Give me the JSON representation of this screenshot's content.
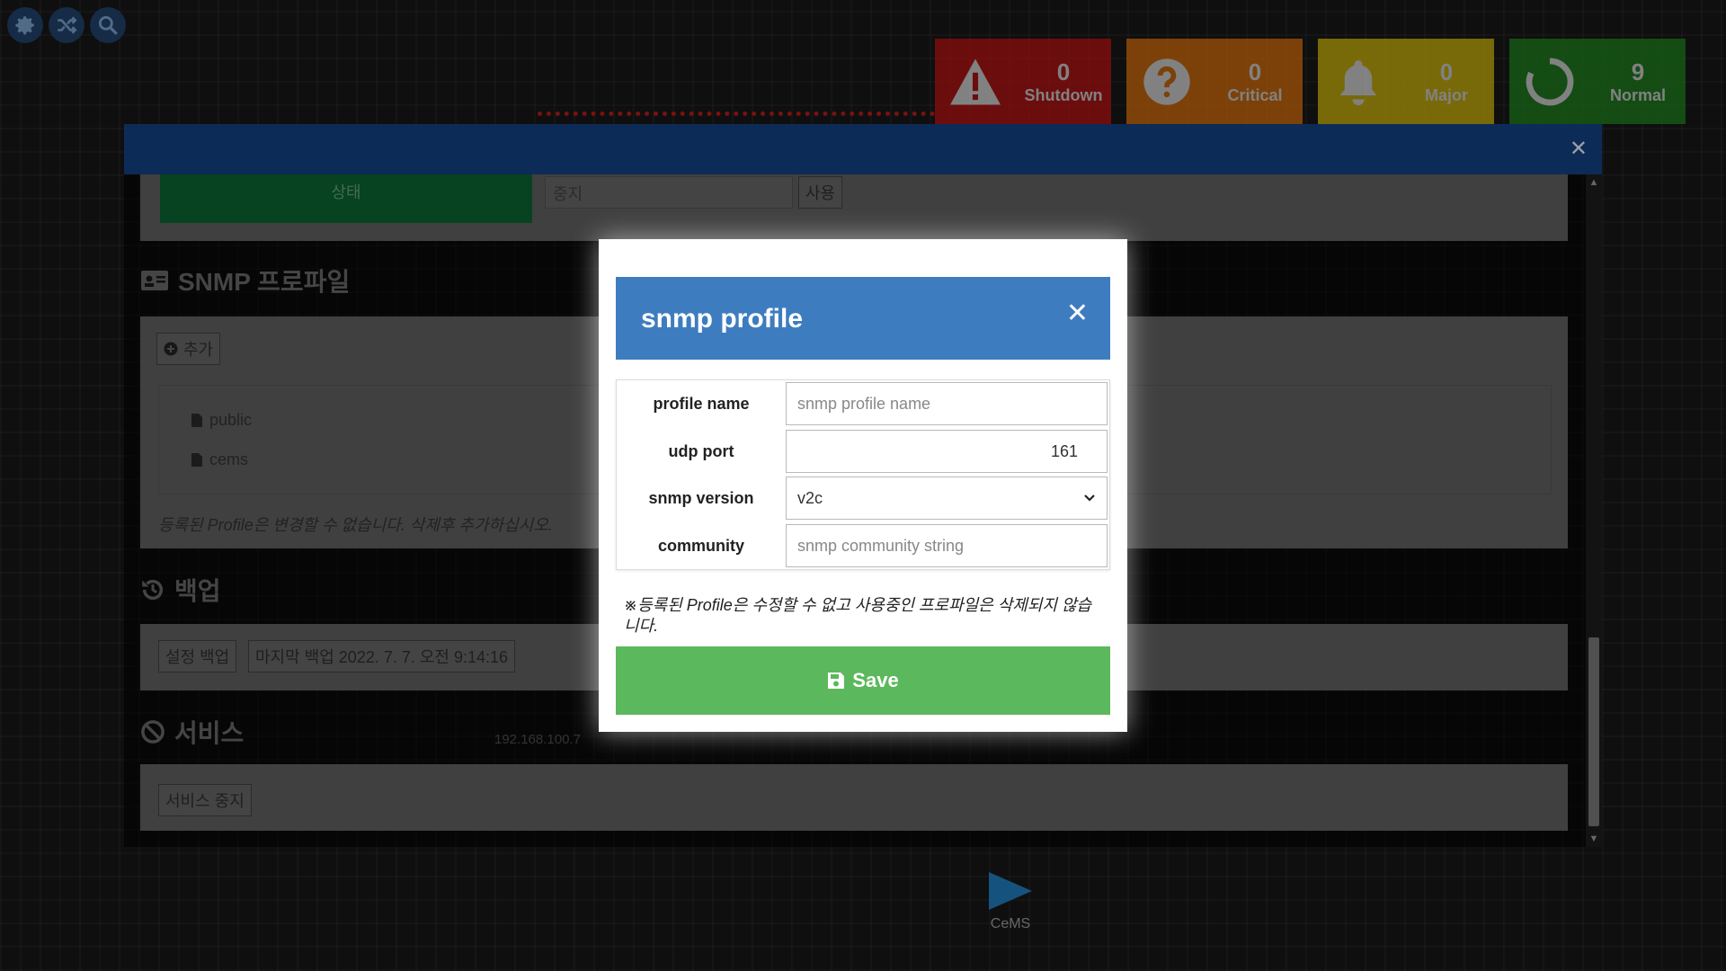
{
  "toolbar": {
    "icons": [
      "settings-icon",
      "shuffle-icon",
      "search-icon"
    ]
  },
  "status": [
    {
      "name": "shutdown",
      "count": "0",
      "label": "Shutdown",
      "color": "#b31212",
      "icon": "warning-icon"
    },
    {
      "name": "critical",
      "count": "0",
      "label": "Critical",
      "color": "#d06a0a",
      "icon": "question-icon"
    },
    {
      "name": "major",
      "count": "0",
      "label": "Major",
      "color": "#c9b00a",
      "icon": "bell-icon"
    },
    {
      "name": "normal",
      "count": "9",
      "label": "Normal",
      "color": "#1e7e1e",
      "icon": "power-icon"
    }
  ],
  "background": {
    "status_label": "상태",
    "stop_value": "중지",
    "use_button": "사용",
    "snmp_section_title": "SNMP 프로파일",
    "add_button": "추가",
    "profiles": [
      "public",
      "cems"
    ],
    "profile_note": "등록된 Profile은 변경할 수 없습니다. 삭제후 추가하십시오.",
    "backup_title": "백업",
    "backup_button": "설정 백업",
    "last_backup": "마지막 백업 2022. 7. 7. 오전 9:14:16",
    "service_title": "서비스",
    "service_stop_button": "서비스 중지",
    "ip_label": "192.168.100.7",
    "cems_label": "CeMS"
  },
  "modal": {
    "title": "snmp profile",
    "fields": {
      "profile_name_label": "profile name",
      "profile_name_placeholder": "snmp profile name",
      "profile_name_value": "",
      "udp_port_label": "udp port",
      "udp_port_value": "161",
      "snmp_version_label": "snmp version",
      "snmp_version_value": "v2c",
      "community_label": "community",
      "community_placeholder": "snmp community string",
      "community_value": ""
    },
    "note": "※등록된 Profile은 수정할 수 없고 사용중인 프로파일은 삭제되지 않습니다.",
    "save_label": "Save"
  },
  "colors": {
    "panel_header": "#123a75",
    "modal_header": "#3d7dbf",
    "save_button": "#5cb85c"
  }
}
